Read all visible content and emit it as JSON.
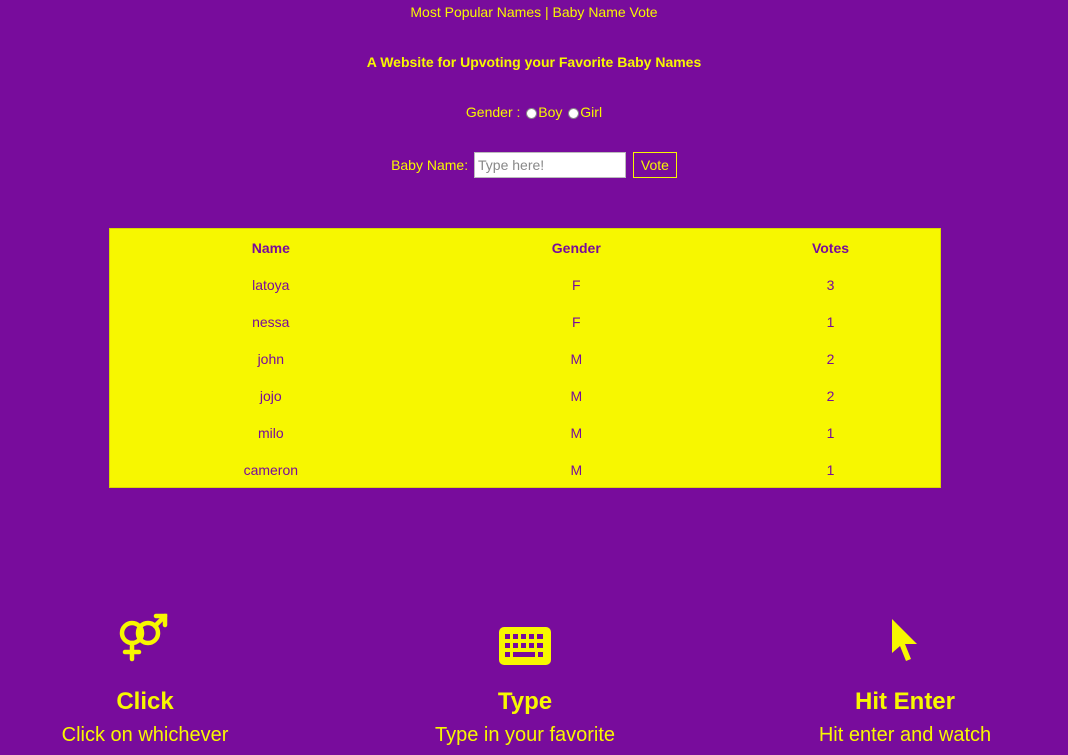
{
  "header": {
    "title": "Most Popular Names | Baby Name Vote",
    "subtitle": "A Website for Upvoting your Favorite Baby Names"
  },
  "form": {
    "gender_label": "Gender :",
    "options": [
      "Boy",
      "Girl"
    ],
    "name_label": "Baby Name:",
    "name_placeholder": "Type here!",
    "vote_label": "Vote"
  },
  "table": {
    "headers": [
      "Name",
      "Gender",
      "Votes"
    ],
    "rows": [
      [
        "latoya",
        "F",
        "3"
      ],
      [
        "nessa",
        "F",
        "1"
      ],
      [
        "john",
        "M",
        "2"
      ],
      [
        "jojo",
        "M",
        "2"
      ],
      [
        "milo",
        "M",
        "1"
      ],
      [
        "cameron",
        "M",
        "1"
      ]
    ]
  },
  "features": [
    {
      "icon": "gender-icon",
      "title": "Click",
      "text": "Click on whichever"
    },
    {
      "icon": "keyboard-icon",
      "title": "Type",
      "text": "Type in your favorite"
    },
    {
      "icon": "cursor-icon",
      "title": "Hit Enter",
      "text": "Hit enter and watch"
    }
  ],
  "colors": {
    "background": "#780c9c",
    "accent": "#f7f700"
  }
}
